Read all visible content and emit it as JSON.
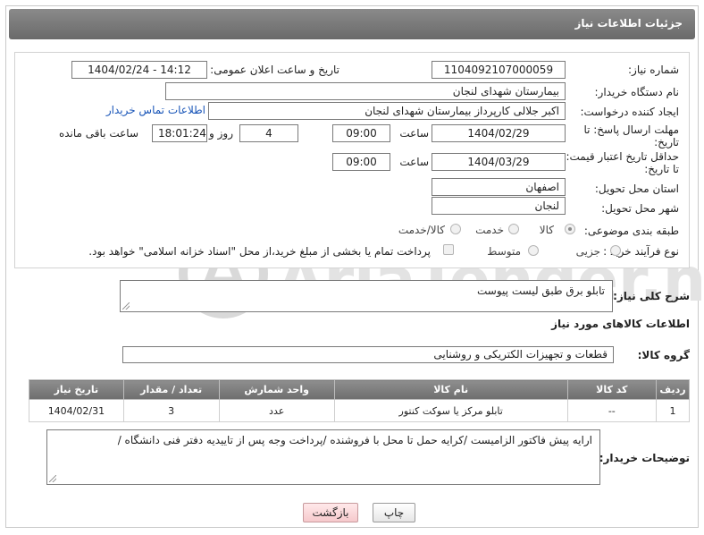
{
  "header": {
    "title": "جزئیات اطلاعات نیاز"
  },
  "form": {
    "need_number": {
      "label": "شماره نیاز:",
      "value": "1104092107000059"
    },
    "announce_datetime": {
      "label": "تاریخ و ساعت اعلان عمومی:",
      "value": "1404/02/24 - 14:12"
    },
    "buyer_org": {
      "label": "نام دستگاه خریدار:",
      "value": "بیمارستان شهدای لنجان"
    },
    "requester": {
      "label": "ایجاد کننده درخواست:",
      "value": "اکبر جلالی کارپرداز بیمارستان شهدای لنجان",
      "contact_link": "اطلاعات تماس خریدار"
    },
    "reply_deadline": {
      "label_line1": "مهلت ارسال پاسخ: تا",
      "label_line2": "تاریخ:",
      "date": "1404/02/29",
      "time_label": "ساعت",
      "time": "09:00",
      "days": "4",
      "days_label": "روز و",
      "remaining": "18:01:24",
      "remaining_label": "ساعت باقی مانده"
    },
    "price_validity": {
      "label_line1": "حداقل تاریخ اعتبار قیمت:",
      "label_line2": "تا تاریخ:",
      "date": "1404/03/29",
      "time_label": "ساعت",
      "time": "09:00"
    },
    "delivery_province": {
      "label": "استان محل تحویل:",
      "value": "اصفهان"
    },
    "delivery_city": {
      "label": "شهر محل تحویل:",
      "value": "لنجان"
    },
    "category": {
      "label": "طبقه بندی موضوعی:",
      "options": [
        "کالا",
        "خدمت",
        "کالا/خدمت"
      ],
      "selected": "کالا"
    },
    "purchase_process": {
      "label": "نوع فرآیند خرید :",
      "options": [
        "جزیی",
        "متوسط"
      ],
      "selected": "جزیی",
      "payment_note": "پرداخت تمام یا بخشی از مبلغ خرید،از محل \"اسناد خزانه اسلامی\" خواهد بود."
    }
  },
  "description": {
    "label": "شرح کلی نیاز:",
    "value": "تابلو برق طبق لیست پیوست"
  },
  "goods_info_title": "اطلاعات کالاهای مورد نیاز",
  "goods_group": {
    "label": "گروه کالا:",
    "value": "قطعات و تجهیزات الکتریکی و روشنایی"
  },
  "table": {
    "headers": [
      "ردیف",
      "کد کالا",
      "نام کالا",
      "واحد شمارش",
      "تعداد / مقدار",
      "تاریخ نیاز"
    ],
    "rows": [
      [
        "1",
        "--",
        "تابلو مرکز یا سوکت کنتور",
        "عدد",
        "3",
        "1404/02/31"
      ]
    ]
  },
  "buyer_notes": {
    "label": "توضیحات خریدار:",
    "value": "ارایه پیش فاکتور الزامیست /کرایه حمل تا محل با فروشنده /پرداخت وجه پس از تاییدیه دفتر فنی دانشگاه /"
  },
  "buttons": {
    "print": "چاپ",
    "back": "بازگشت"
  },
  "watermark": {
    "text": "AriaTender.net"
  }
}
